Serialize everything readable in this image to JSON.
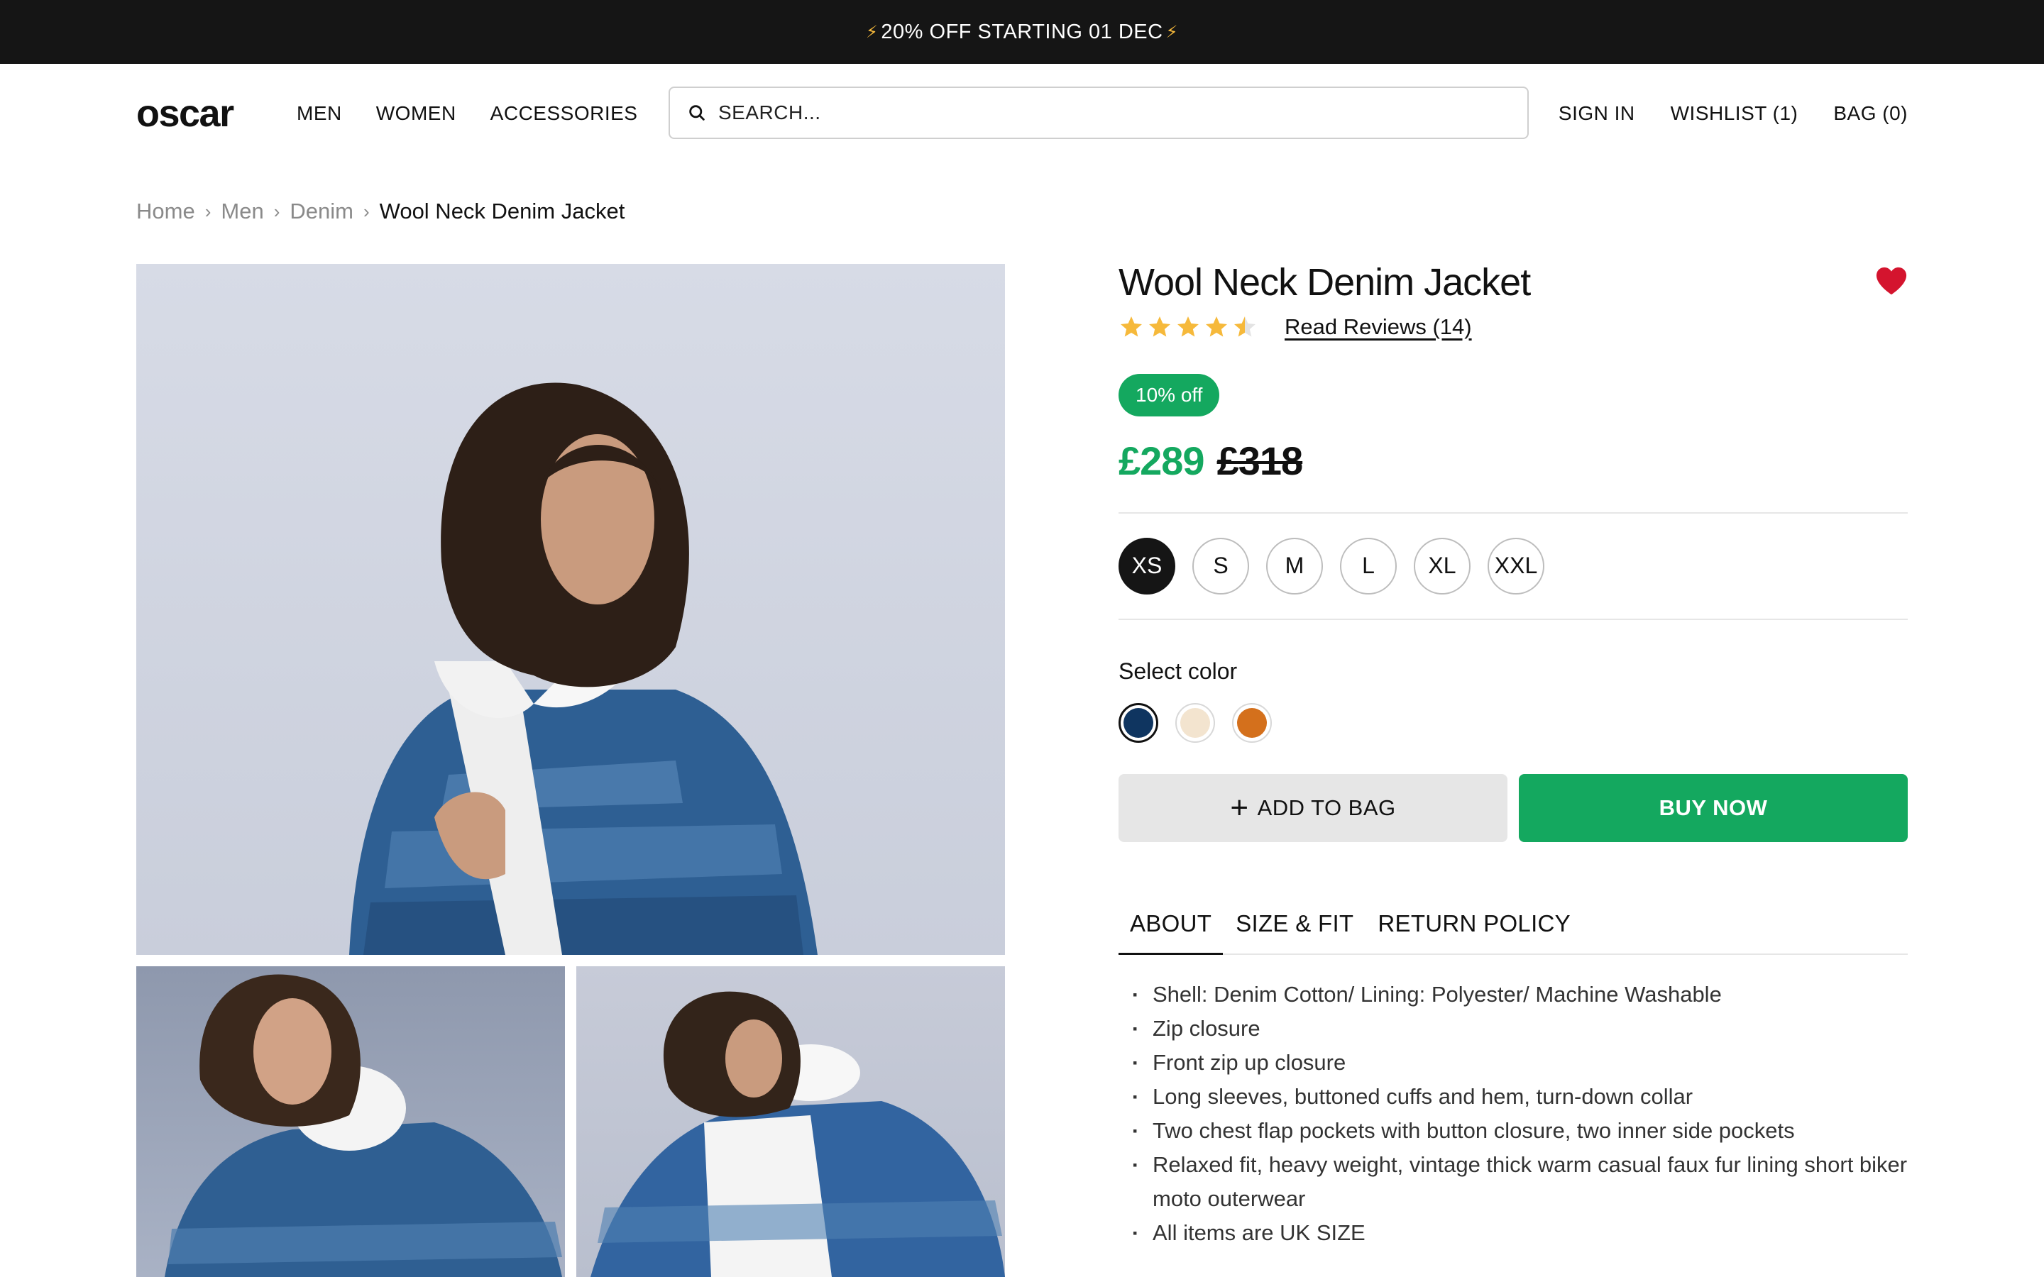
{
  "promo": {
    "bolt": "⚡",
    "text": "20% OFF STARTING 01 DEC"
  },
  "header": {
    "logo": "oscar",
    "nav": [
      "MEN",
      "WOMEN",
      "ACCESSORIES"
    ],
    "search_placeholder": "SEARCH...",
    "sign_in": "SIGN IN",
    "wishlist": "WISHLIST (1)",
    "bag": "BAG (0)"
  },
  "breadcrumb": [
    "Home",
    "Men",
    "Denim",
    "Wool Neck Denim Jacket"
  ],
  "product": {
    "title": "Wool Neck Denim Jacket",
    "rating": 4.5,
    "rating_max": 5,
    "reviews_link": "Read Reviews (14)",
    "discount_badge": "10% off",
    "price_now": "£289",
    "price_was": "£318",
    "sizes": [
      "XS",
      "S",
      "M",
      "L",
      "XL",
      "XXL"
    ],
    "selected_size": "XS",
    "color_label": "Select color",
    "colors": [
      "#0f3560",
      "#f3e4cf",
      "#d4701c"
    ],
    "selected_color": "#0f3560",
    "add_to_bag": "ADD TO BAG",
    "buy_now": "BUY NOW",
    "tabs": [
      "ABOUT",
      "SIZE & FIT",
      "RETURN POLICY"
    ],
    "active_tab": "ABOUT",
    "about": [
      "Shell: Denim Cotton/ Lining: Polyester/ Machine Washable",
      "Zip closure",
      "Front zip up closure",
      "Long sleeves, buttoned cuffs and hem, turn-down collar",
      "Two chest flap pockets with button closure, two inner side pockets",
      "Relaxed fit, heavy weight, vintage thick warm casual faux fur lining short biker moto outerwear",
      "All items are UK SIZE"
    ]
  },
  "colors": {
    "accent": "#14a85f",
    "heart": "#d4142e",
    "star": "#f6b93b",
    "promo_bg": "#151515"
  }
}
